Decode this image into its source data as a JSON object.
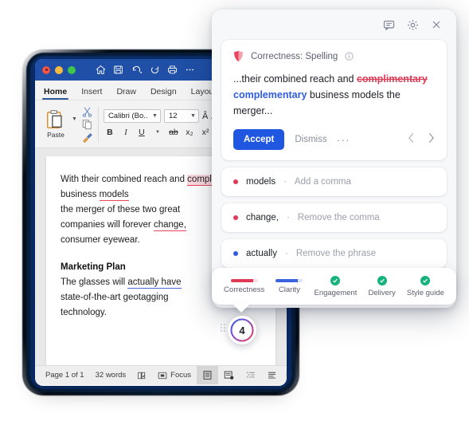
{
  "word": {
    "titlebar": {
      "quick_access": [
        "home-icon",
        "save-icon",
        "undo-icon",
        "redo-icon",
        "print-icon",
        "more-icon"
      ],
      "traffic_lights": [
        "close",
        "minimize",
        "maximize"
      ]
    },
    "ribbon_tabs": [
      {
        "label": "Home",
        "active": true
      },
      {
        "label": "Insert",
        "active": false
      },
      {
        "label": "Draw",
        "active": false
      },
      {
        "label": "Design",
        "active": false
      },
      {
        "label": "Layout",
        "active": false
      }
    ],
    "clipboard": {
      "paste_label": "Paste",
      "cut_icon": "scissors-icon",
      "copy_icon": "copy-icon",
      "painter_icon": "format-painter-icon"
    },
    "font": {
      "family_value": "Calibri (Bo...",
      "size_value": "12",
      "grow_icon": "increase-font-size-icon",
      "buttons": [
        "B",
        "I",
        "U",
        "ab",
        "x₂",
        "x²"
      ]
    },
    "document": {
      "para1": {
        "pre": "With their combined reach and ",
        "error_word": "complimentary",
        "mid": " business ",
        "error_word2": "models",
        "after2": "",
        "line3": "the merger of these two great",
        "line4_pre": "companies will forever ",
        "error_word3": "change,",
        "line5": "consumer eyewear."
      },
      "para2": {
        "heading": "Marketing Plan",
        "pre": "The glasses will ",
        "error_phrase": "actually have",
        "line2": "state-of-the-art geotagging",
        "line3": "technology."
      }
    },
    "statusbar": {
      "page": "Page 1 of 1",
      "words": "32 words",
      "proofing_icon": "proofing-icon",
      "focus_label": "Focus",
      "focus_icon": "focus-icon",
      "view_icons": [
        "print-layout-icon",
        "web-layout-icon",
        "outline-icon",
        "draft-icon"
      ],
      "zoom_minus": "−",
      "zoom_plus": "+"
    }
  },
  "grammarly": {
    "toolbar": {
      "feedback_icon": "feedback-chat-icon",
      "settings_icon": "gear-icon",
      "close_icon": "close-icon"
    },
    "main_card": {
      "shield_icon": "correctness-shield-icon",
      "category": "Correctness: Spelling",
      "info_icon": "info-icon",
      "sentence_pre": "...their combined reach and ",
      "sentence_strike": "complimentary",
      "sentence_fix": "complementary",
      "sentence_post": " business models the merger...",
      "accept_label": "Accept",
      "dismiss_label": "Dismiss",
      "more_label": "···",
      "prev_icon": "chevron-left-icon",
      "next_icon": "chevron-right-icon"
    },
    "suggestions": [
      {
        "word": "models",
        "sep": "·",
        "action": "Add a comma",
        "color": "red"
      },
      {
        "word": "change,",
        "sep": "·",
        "action": "Remove the comma",
        "color": "red"
      },
      {
        "word": "actually",
        "sep": "·",
        "action": "Remove the phrase",
        "color": "blue"
      }
    ],
    "tabs": [
      {
        "label": "Correctness",
        "indicator": "bar",
        "color": "#e03b56"
      },
      {
        "label": "Clarity",
        "indicator": "bar",
        "color": "#3b63e0"
      },
      {
        "label": "Engagement",
        "indicator": "check",
        "color": "#15b37a"
      },
      {
        "label": "Delivery",
        "indicator": "check",
        "color": "#15b37a"
      },
      {
        "label": "Style guide",
        "indicator": "check",
        "color": "#15b37a"
      }
    ],
    "badge": {
      "count": "4",
      "drag_handle_icon": "drag-handle-icon"
    }
  },
  "colors": {
    "accent_blue": "#1f57e0",
    "error_red": "#e03b56",
    "success_green": "#15b37a",
    "word_blue": "#1f4fa6"
  }
}
